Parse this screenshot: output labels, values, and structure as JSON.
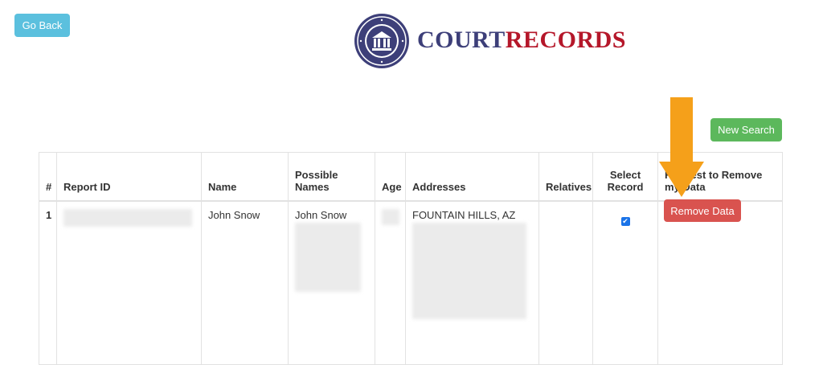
{
  "header": {
    "go_back_label": "Go Back",
    "logo": {
      "court": "COURT",
      "records": "RECORDS",
      "seal_text": "COURT RECORDS"
    }
  },
  "toolbar": {
    "new_search_label": "New Search"
  },
  "table": {
    "columns": [
      "#",
      "Report ID",
      "Name",
      "Possible Names",
      "Age",
      "Addresses",
      "Relatives",
      "Select Record",
      "Request to Remove my Data"
    ],
    "rows": [
      {
        "index": "1",
        "report_id": "",
        "name": "John Snow",
        "possible_names": "John Snow",
        "age": "",
        "addresses": "FOUNTAIN HILLS, AZ",
        "relatives": "",
        "selected": true,
        "remove_label": "Remove Data"
      }
    ]
  },
  "colors": {
    "go_back": "#5bc0de",
    "new_search": "#5cb85c",
    "remove": "#d9534f",
    "arrow": "#f5a01a",
    "logo_navy": "#3d3f79",
    "logo_red": "#b5172a"
  }
}
